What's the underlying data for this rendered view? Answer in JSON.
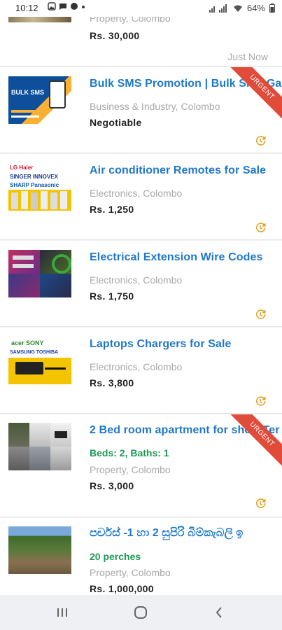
{
  "status_bar": {
    "time": "10:12",
    "battery": "64%"
  },
  "listings": [
    {
      "category_location": "Property, Colombo",
      "price": "Rs. 30,000",
      "posted": "Just Now"
    },
    {
      "title": "Bulk SMS Promotion | Bulk SMS Ga",
      "category_location": "Business & Industry, Colombo",
      "price": "Negotiable",
      "badge": "URGENT",
      "thumb_text": [
        "BULK SMS"
      ]
    },
    {
      "title": "Air conditioner Remotes for Sale",
      "category_location": "Electronics, Colombo",
      "price": "Rs. 1,250",
      "thumb_text": [
        "LG Haier",
        "SINGER INNOVEX",
        "SHARP Panasonic"
      ]
    },
    {
      "title": "Electrical Extension Wire Codes",
      "category_location": "Electronics, Colombo",
      "price": "Rs. 1,750"
    },
    {
      "title": "Laptops Chargers for Sale",
      "category_location": "Electronics, Colombo",
      "price": "Rs. 3,800",
      "thumb_text": [
        "acer SONY",
        "SAMSUNG TOSHIBA"
      ]
    },
    {
      "title": "2 Bed room apartment for short Ter",
      "attributes": "Beds: 2, Baths: 1",
      "category_location": "Property, Colombo",
      "price": "Rs. 3,000",
      "badge": "URGENT"
    },
    {
      "title": "පර්චස් -1 හා 2 සුපිරි බිම්කැබලි ඉ",
      "attributes": "20 perches",
      "category_location": "Property, Colombo",
      "price": "Rs. 1,000,000"
    }
  ],
  "icons": {
    "history": "history-icon",
    "recents": "recent-apps-icon",
    "home": "home-icon",
    "back": "back-icon"
  },
  "colors": {
    "title": "#1f78c8",
    "attributes": "#1f9a55",
    "urgent_ribbon": "#e04b3a",
    "history_icon": "#e0a020"
  }
}
